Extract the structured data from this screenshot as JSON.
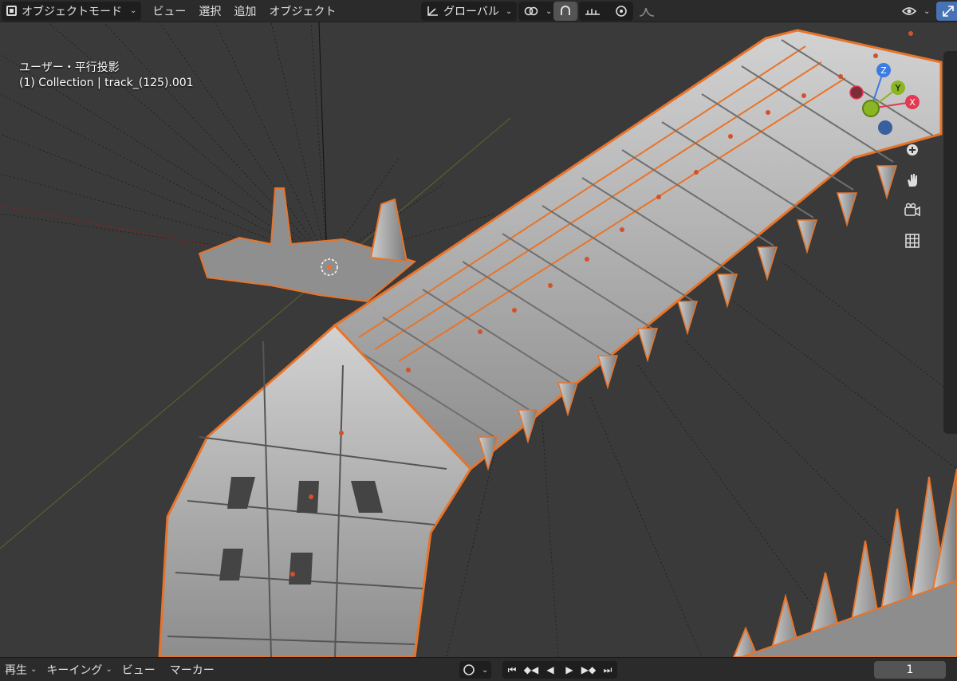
{
  "header": {
    "mode": "オブジェクトモード",
    "menus": [
      "ビュー",
      "選択",
      "追加",
      "オブジェクト"
    ],
    "transform_orientation": "グローバル"
  },
  "viewport": {
    "view_label": "ユーザー・平行投影",
    "object_info": "(1) Collection | track_(125).001",
    "gizmo": {
      "z": "Z",
      "y": "Y",
      "x": "X"
    }
  },
  "icons": [
    "object-mode-icon",
    "orientation-icon",
    "link-icon",
    "snap-icon",
    "snap-increment-icon",
    "proportional-icon",
    "falloff-icon",
    "visibility-icon",
    "gizmo-toggle-icon",
    "zoom-icon",
    "hand-icon",
    "camera-icon",
    "grid-icon"
  ],
  "timeline": {
    "playback": "再生",
    "keying": "キーイング",
    "view": "ビュー",
    "marker": "マーカー",
    "frame": "1"
  },
  "colors": {
    "accent": "#4772b3",
    "selection_outline": "#e8742a",
    "axis_x": "#e23a52",
    "axis_y": "#8bb624",
    "axis_z": "#3a7ce2"
  }
}
